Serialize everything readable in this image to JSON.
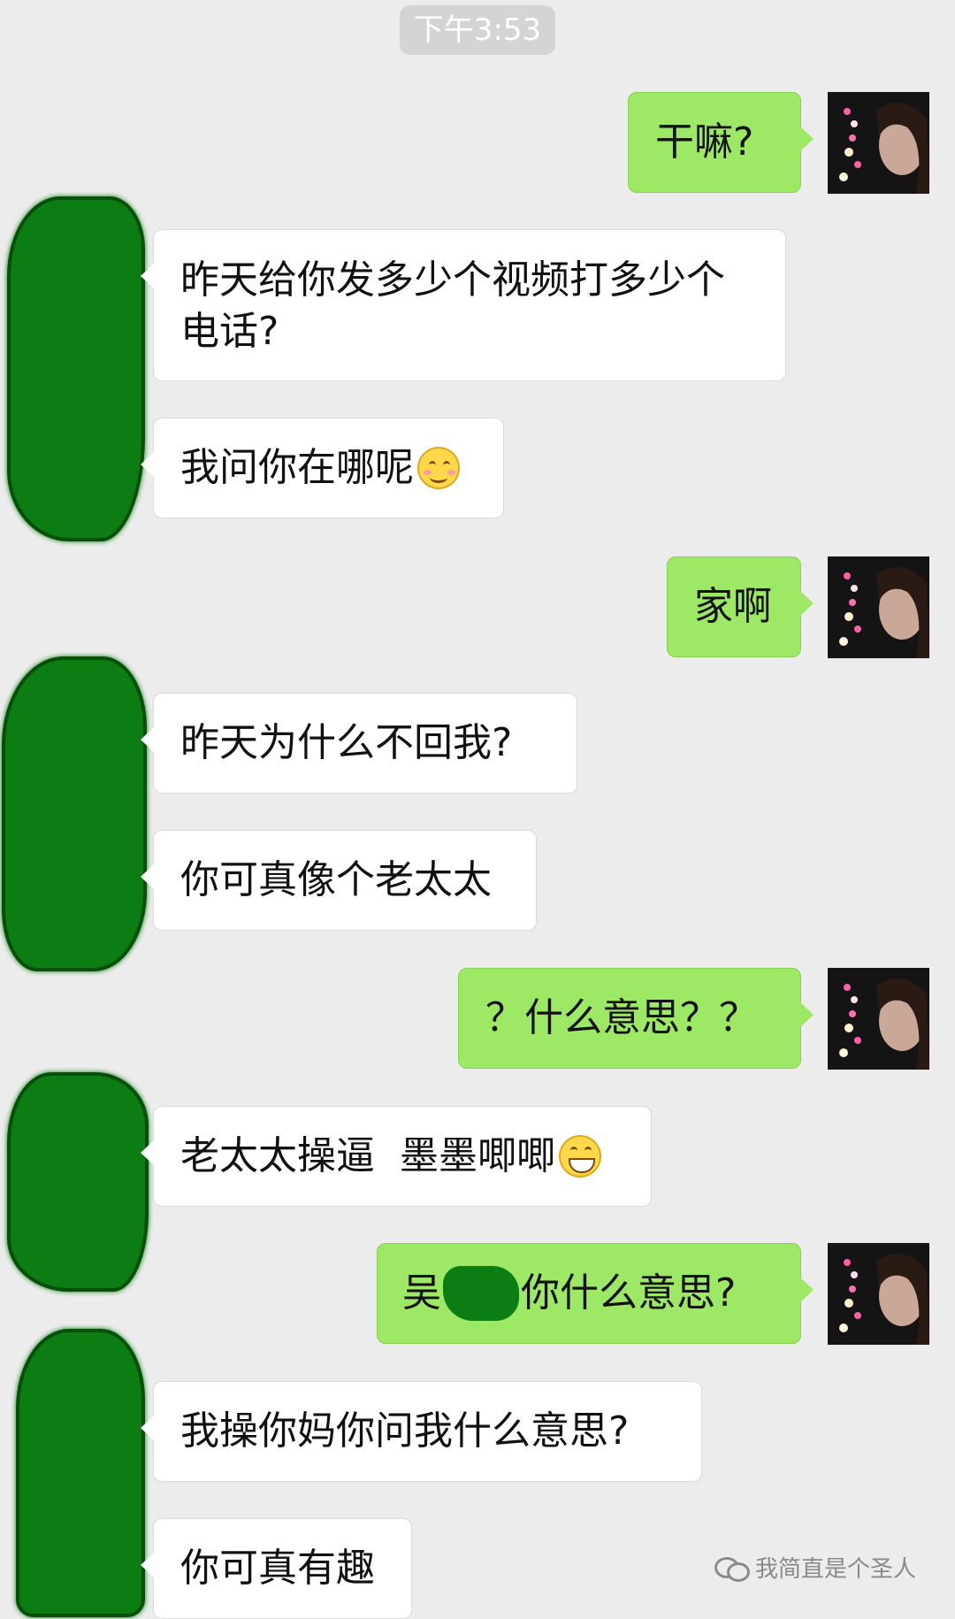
{
  "header": {
    "time": "下午3:53"
  },
  "messages": [
    {
      "side": "out",
      "text": "干嘛?"
    },
    {
      "side": "in",
      "text": "昨天给你发多少个视频打多少个电话?"
    },
    {
      "side": "in",
      "text": "我问你在哪呢",
      "emoji": "smiling-blush-emoji"
    },
    {
      "side": "out",
      "text": "家啊"
    },
    {
      "side": "in",
      "text": "昨天为什么不回我?"
    },
    {
      "side": "in",
      "text": "你可真像个老太太"
    },
    {
      "side": "out",
      "text": "？什么意思？？"
    },
    {
      "side": "in",
      "text": "老太太操逼  墨墨唧唧",
      "emoji": "grinning-emoji"
    },
    {
      "side": "out",
      "text_before": "吴",
      "text_after": "你什么意思?"
    },
    {
      "side": "in",
      "text": "我操你妈你问我什么意思?"
    },
    {
      "side": "in",
      "text": "你可真有趣"
    }
  ],
  "watermark": {
    "text": "我简直是个圣人",
    "icon": "wechat-icon"
  },
  "colors": {
    "background": "#ececec",
    "outgoing_bubble": "#9de864",
    "incoming_bubble": "#ffffff",
    "redaction": "#0b7d12"
  }
}
